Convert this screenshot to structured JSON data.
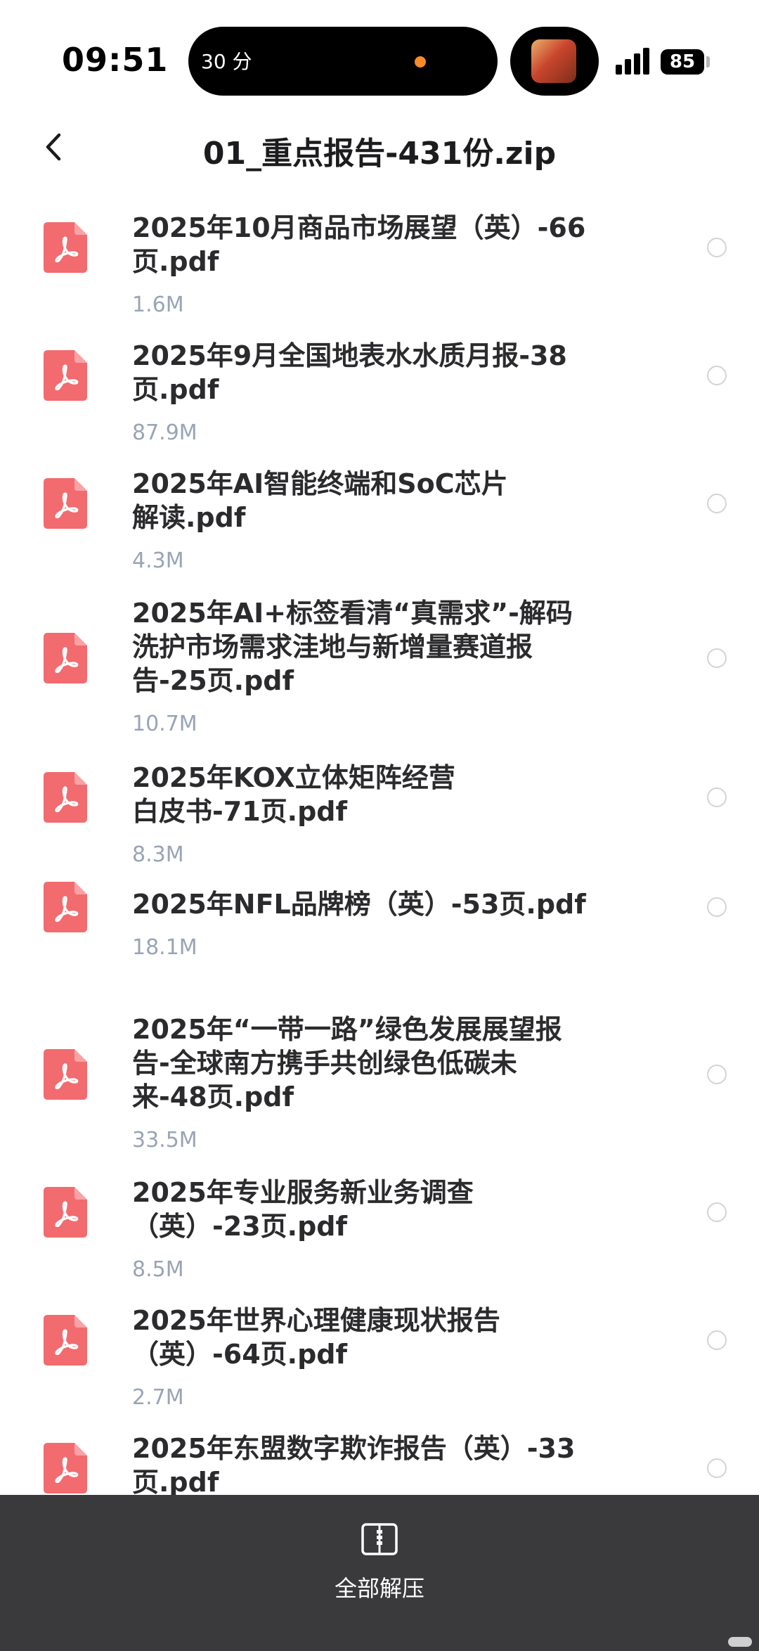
{
  "status_bar": {
    "time": "09:51",
    "island_text": "30 分",
    "battery": "85"
  },
  "header": {
    "title": "01_重点报告-431份.zip",
    "back_icon": "chevron-left-icon"
  },
  "files": [
    {
      "name_lines": [
        "2025年10月商品市场展望（英）-66",
        "页.pdf"
      ],
      "size": "1.6M"
    },
    {
      "name_lines": [
        "2025年9月全国地表水水质月报-38",
        "页.pdf"
      ],
      "size": "87.9M"
    },
    {
      "name_lines": [
        "2025年AI智能终端和SoC芯片",
        "解读.pdf"
      ],
      "size": "4.3M"
    },
    {
      "name_lines": [
        "2025年AI+标签看清“真需求”-解码",
        "洗护市场需求洼地与新增量赛道报",
        "告-25页.pdf"
      ],
      "size": "10.7M"
    },
    {
      "name_lines": [
        "2025年KOX立体矩阵经营",
        "白皮书-71页.pdf"
      ],
      "size": "8.3M"
    },
    {
      "name_lines": [
        "2025年NFL品牌榜（英）-53页.pdf"
      ],
      "size": "18.1M"
    },
    {
      "name_lines": [
        "2025年“一带一路”绿色发展展望报",
        "告-全球南方携手共创绿色低碳未",
        "来-48页.pdf"
      ],
      "size": "33.5M"
    },
    {
      "name_lines": [
        "2025年专业服务新业务调查",
        "（英）-23页.pdf"
      ],
      "size": "8.5M"
    },
    {
      "name_lines": [
        "2025年世界心理健康现状报告",
        "（英）-64页.pdf"
      ],
      "size": "2.7M"
    },
    {
      "name_lines": [
        "2025年东盟数字欺诈报告（英）-33",
        "页.pdf"
      ],
      "size": ""
    }
  ],
  "bottom_bar": {
    "extract_all_label": "全部解压",
    "extract_icon": "zip-folder-icon"
  },
  "colors": {
    "pdf_icon": "#f26b6f",
    "bottom_bar": "#3a3a3c",
    "size_text": "#9aa4b6"
  }
}
